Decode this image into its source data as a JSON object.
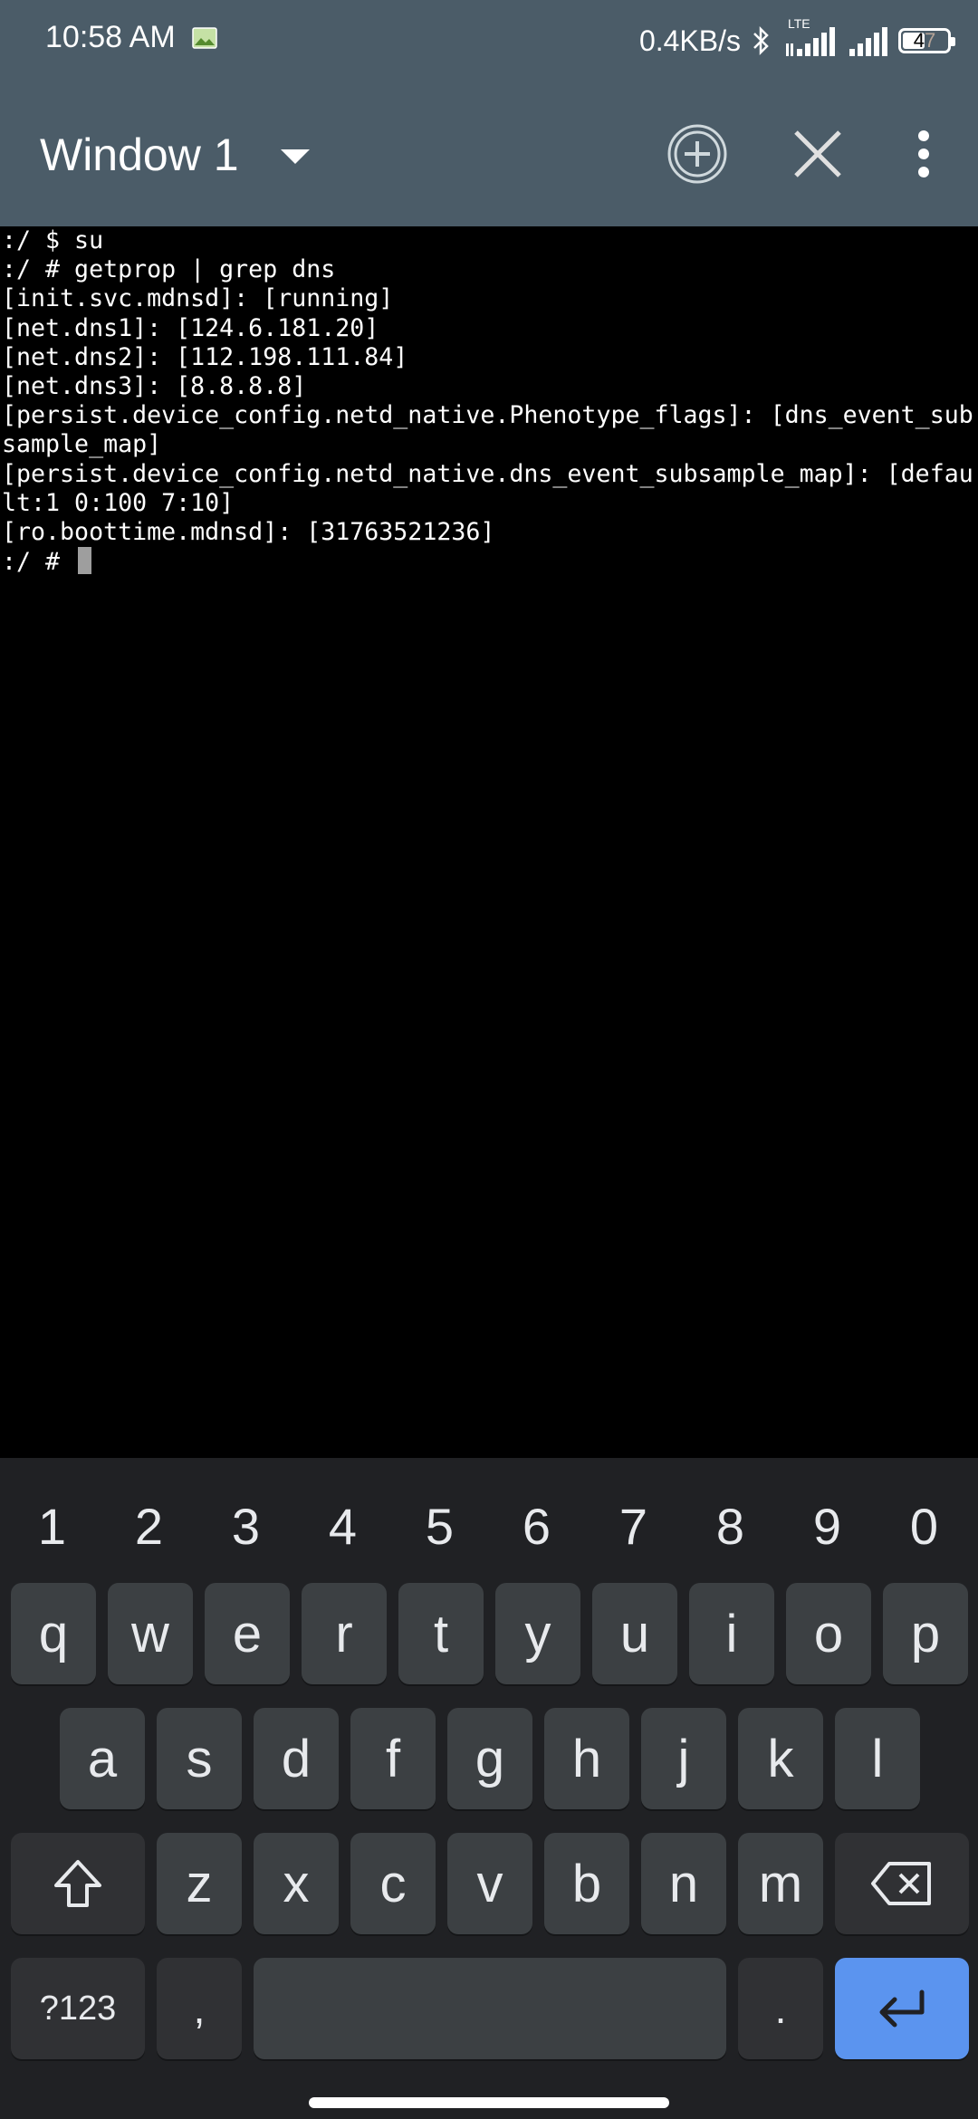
{
  "status_bar": {
    "time": "10:58 AM",
    "net_speed": "0.4KB/s",
    "network_type": "LTE",
    "battery": "47",
    "icons": [
      "image-icon",
      "bluetooth-icon",
      "signal-icon",
      "signal-icon",
      "battery-icon"
    ]
  },
  "app_bar": {
    "title": "Window 1",
    "actions": [
      "add-window-icon",
      "close-window-icon",
      "overflow-menu-icon"
    ]
  },
  "terminal": {
    "lines": [
      ":/ $ su",
      ":/ # getprop | grep dns",
      "[init.svc.mdnsd]: [running]",
      "[net.dns1]: [124.6.181.20]",
      "[net.dns2]: [112.198.111.84]",
      "[net.dns3]: [8.8.8.8]",
      "[persist.device_config.netd_native.Phenotype_flags]: [dns_event_sub",
      "sample_map]",
      "[persist.device_config.netd_native.dns_event_subsample_map]: [defau",
      "lt:1 0:100 7:10]",
      "[ro.boottime.mdnsd]: [31763521236]"
    ],
    "prompt": ":/ #"
  },
  "keyboard": {
    "numbers": [
      "1",
      "2",
      "3",
      "4",
      "5",
      "6",
      "7",
      "8",
      "9",
      "0"
    ],
    "row1": [
      "q",
      "w",
      "e",
      "r",
      "t",
      "y",
      "u",
      "i",
      "o",
      "p"
    ],
    "row2": [
      "a",
      "s",
      "d",
      "f",
      "g",
      "h",
      "j",
      "k",
      "l"
    ],
    "row3": [
      "z",
      "x",
      "c",
      "v",
      "b",
      "n",
      "m"
    ],
    "symbols_key": "?123",
    "comma_key": ",",
    "period_key": ".",
    "accent_color": "#5b94ef"
  }
}
